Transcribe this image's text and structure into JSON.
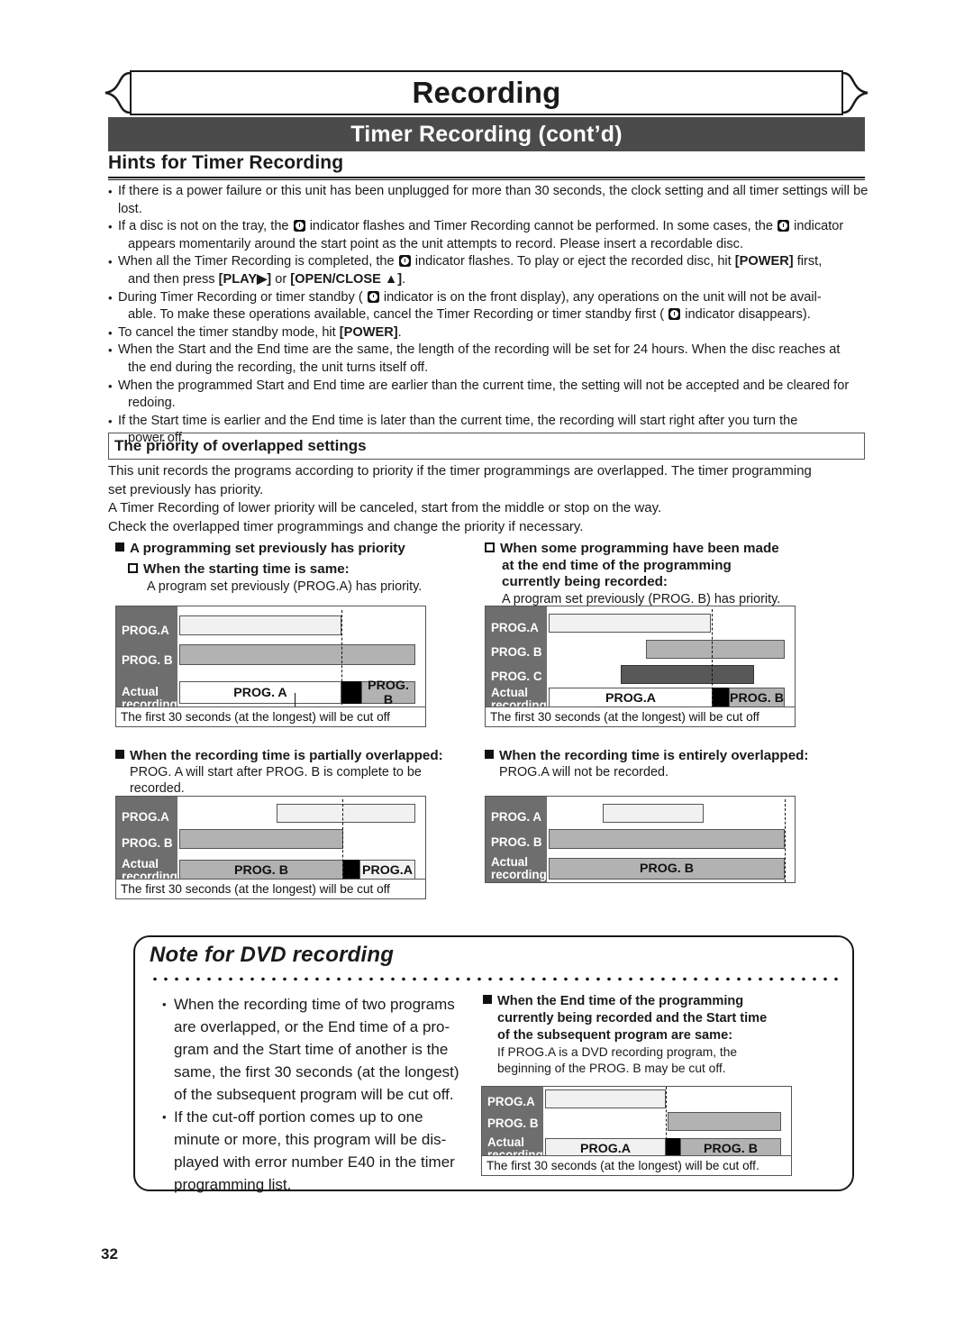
{
  "header": {
    "banner_title": "Recording",
    "subbar_title": "Timer Recording (cont’d)",
    "section_title": "Hints for Timer Recording"
  },
  "hints": [
    "If there is a power failure or this unit has been unplugged for more than 30 seconds, the clock setting and all timer settings will be lost.",
    "If a disc is not on the tray, the ⏰ indicator flashes and Timer Recording cannot be performed. In some cases, the ⏰ indicator appears momentarily around the start point as the unit attempts to record. Please insert a recordable disc.",
    "When all the Timer Recording is completed, the ⏰ indicator flashes. To play or eject the recorded disc, hit [POWER] first, and then press [PLAY▶] or [OPEN/CLOSE ▲].",
    "During Timer Recording or timer standby ( ⏰ indicator is on the front display), any operations on the unit will not be available. To make these operations available, cancel the Timer Recording or timer standby first ( ⏰ indicator disappears).",
    "To cancel the timer standby mode, hit [POWER].",
    "When the Start and the End time are the same, the length of the recording will be set for 24 hours. When the disc reaches at the end during the recording, the unit turns itself off.",
    "When the programmed Start and End time are earlier than the current time, the setting will not be accepted and be cleared for redoing.",
    "If the Start time is earlier and the End time is later than the current time, the recording will start right after you turn the power off."
  ],
  "hint_lines": {
    "l1": "If there is a power failure or this unit has been unplugged for more than 30 seconds, the clock setting and all timer settings will be lost.",
    "l2a_1": "If a disc is not on the tray, the",
    "l2a_2": "indicator flashes and Timer Recording cannot be performed. In some cases, the",
    "l2a_3": "indicator",
    "l2b": "appears momentarily around the start point as the unit attempts to record. Please insert a recordable disc.",
    "l3a_1": "When all the Timer Recording is completed, the",
    "l3a_2": "indicator flashes. To play or eject the recorded disc, hit",
    "l3a_3": "[POWER]",
    "l3a_4": "first,",
    "l3b_1": "and then press",
    "l3b_2": "[PLAY▶]",
    "l3b_3": "or",
    "l3b_4": "[OPEN/CLOSE ▲]",
    "l3b_5": ".",
    "l4a_1": "During Timer Recording or timer standby (",
    "l4a_2": "indicator is on the front display), any operations on the unit will not be avail-",
    "l4b_1": "able. To make these operations available, cancel the Timer Recording or timer standby first (",
    "l4b_2": "indicator disappears).",
    "l5_1": "To cancel the timer standby mode, hit",
    "l5_2": "[POWER]",
    "l5_3": ".",
    "l6a": "When the Start and the End time are the same, the length of the recording will be set for 24 hours. When the disc reaches at",
    "l6b": "the end during the recording, the unit turns itself off.",
    "l7a": "When the programmed Start and End time are earlier than the current time, the setting will not be accepted and be cleared for",
    "l7b": "redoing.",
    "l8a": "If the Start time is earlier and the End time is later than the current time, the recording will start right after you turn the",
    "l8b": "power off."
  },
  "priority": {
    "heading": "The priority of overlapped settings",
    "p1": "This unit records the programs according to priority if the timer programmings are overlapped. The timer programming set previously has priority.",
    "p1a": "This unit records the programs according to priority if the timer programmings are overlapped. The timer programming",
    "p1b": "set previously has priority.",
    "p2": " A Timer Recording of lower priority will be canceled, start from the middle or stop on the way.",
    "p3": "Check the overlapped timer programmings and change the priority if necessary."
  },
  "diagrams": [
    {
      "id": "same-start-time",
      "heading": "A programming set previously has priority",
      "subheading": "When the starting time is same:",
      "note": "A program set previously (PROG.A) has priority.",
      "caption": "The first 30 seconds (at the longest) will be cut off",
      "rows": [
        "PROG.A",
        "PROG. B",
        "Actual\nrecording"
      ],
      "row_labels": {
        "r1": "PROG.A",
        "r2": "PROG. B",
        "r3l1": "Actual",
        "r3l2": "recording"
      },
      "actual_segments": [
        "PROG. A",
        "PROG. B"
      ]
    },
    {
      "id": "end-time-overlap",
      "subheading_l1": "When some programming have been made",
      "subheading_l2": "at the end time of the programming",
      "subheading_l3": "currently being recorded:",
      "note": "A program set previously (PROG. B) has priority.",
      "caption": "The first 30 seconds (at the longest) will be cut off",
      "row_labels": {
        "r1": "PROG.A",
        "r2": "PROG. B",
        "r3": "PROG. C",
        "r4l1": "Actual",
        "r4l2": "recording"
      },
      "actual_segments": [
        "PROG.A",
        "PROG. B"
      ]
    },
    {
      "id": "partially-overlapped",
      "heading": "When the recording time is partially overlapped:",
      "note_l1": "PROG. A will start after PROG. B is complete to be",
      "note_l2": "recorded.",
      "caption": "The first 30 seconds (at the longest) will be cut off",
      "row_labels": {
        "r1": "PROG.A",
        "r2": "PROG. B",
        "r3l1": "Actual",
        "r3l2": "recording"
      },
      "actual_segments": [
        "PROG. B",
        "PROG.A"
      ]
    },
    {
      "id": "entirely-overlapped",
      "heading": "When the recording time is entirely overlapped:",
      "note": "PROG.A will not be recorded.",
      "row_labels": {
        "r1": "PROG. A",
        "r2": "PROG. B",
        "r3l1": "Actual",
        "r3l2": "recording"
      },
      "actual_segments": [
        "PROG. B"
      ]
    },
    {
      "id": "dvd-end-start-same",
      "heading_l1": "When the End time of the programming",
      "heading_l2": "currently being recorded and the Start time",
      "heading_l3": "of the subsequent program are same:",
      "note_l1": "If PROG.A is a DVD recording program, the",
      "note_l2": "beginning of the PROG. B may be cut off.",
      "caption": "The first 30 seconds (at the longest) will be cut off.",
      "row_labels": {
        "r1": "PROG.A",
        "r2": "PROG. B",
        "r3l1": "Actual",
        "r3l2": "recording"
      },
      "actual_segments": [
        "PROG.A",
        "PROG. B"
      ]
    }
  ],
  "note_box": {
    "title": "Note for DVD recording",
    "bullet1_lines": [
      "When the recording time of two programs",
      "are overlapped, or the End time of a pro-",
      "gram and the Start time of another is the",
      "same, the first 30 seconds (at the longest)",
      "of the subsequent program will be cut off."
    ],
    "bullet2_lines": [
      "If the cut-off portion comes up to one",
      "minute or more, this program will be dis-",
      "played with error number E40 in the timer",
      "programming list."
    ]
  },
  "footer": {
    "page_number": "32"
  },
  "colors": {
    "subbar_bg": "#4b4b4b",
    "label_bg": "#6e6e6e",
    "prog_a_fill": "#f1f1f1",
    "prog_b_fill": "#b2b2b2",
    "prog_c_fill": "#585858",
    "cut_fill": "#000000"
  }
}
